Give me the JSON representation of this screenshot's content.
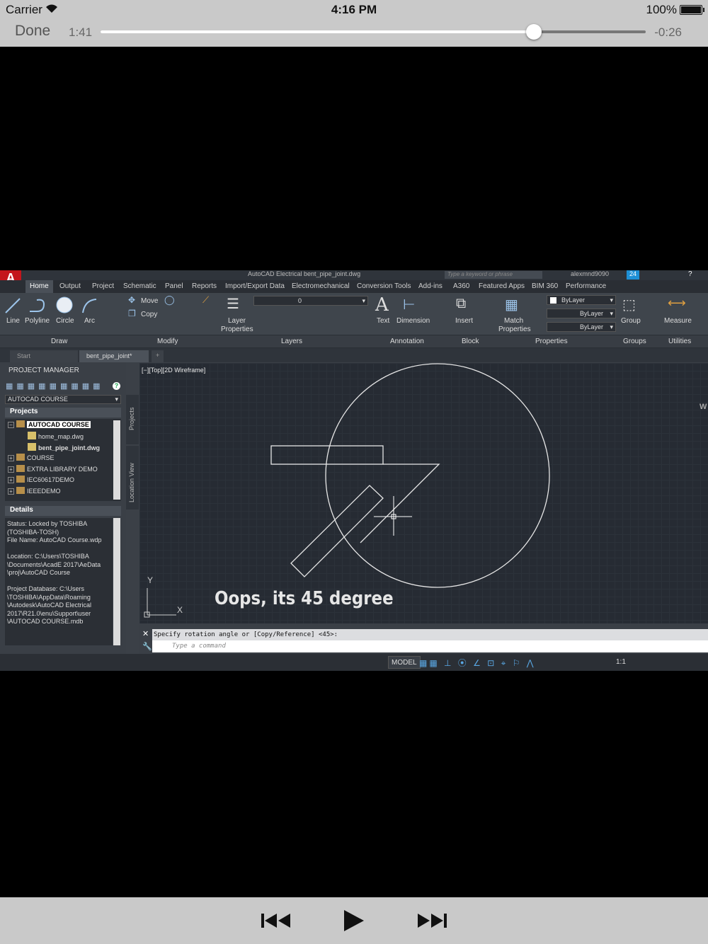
{
  "status_bar": {
    "carrier": "Carrier",
    "time": "4:16 PM",
    "battery": "100%",
    "battery_level": 1.0
  },
  "player": {
    "done_label": "Done",
    "elapsed": "1:41",
    "remaining": "-0:26",
    "progress": 0.795
  },
  "autocad": {
    "logo_letter": "A",
    "title": "AutoCAD Electrical   bent_pipe_joint.dwg",
    "search_placeholder": "Type a keyword or phrase",
    "user": "alexmnd9090",
    "notifications": "24",
    "ribbon_tabs": [
      "Home",
      "Output",
      "Project",
      "Schematic",
      "Panel",
      "Reports",
      "Import/Export Data",
      "Electromechanical",
      "Conversion Tools",
      "Add-ins",
      "A360",
      "Featured Apps",
      "BIM 360",
      "Performance"
    ],
    "tools": {
      "line": "Line",
      "polyline": "Polyline",
      "circle": "Circle",
      "arc": "Arc",
      "move": "Move",
      "copy": "Copy",
      "layer_properties_1": "Layer",
      "layer_properties_2": "Properties",
      "layer_value": "0",
      "text": "Text",
      "dimension": "Dimension",
      "insert": "Insert",
      "match_1": "Match",
      "match_2": "Properties",
      "bylayer_color": "ByLayer",
      "bylayer_linetype": "ByLayer",
      "bylayer_lineweight": "ByLayer",
      "group": "Group",
      "measure": "Measure"
    },
    "panels": {
      "draw": "Draw",
      "modify": "Modify",
      "layers": "Layers",
      "annotation": "Annotation",
      "block": "Block",
      "properties": "Properties",
      "groups": "Groups",
      "utilities": "Utilities"
    },
    "doc_tabs": {
      "start": "Start",
      "active": "bent_pipe_joint*",
      "new": "+"
    },
    "project_manager": {
      "title": "PROJECT MANAGER",
      "project_combo": "AUTOCAD COURSE",
      "projects_header": "Projects",
      "tree": [
        {
          "label": "AUTOCAD COURSE"
        },
        {
          "label": "home_map.dwg"
        },
        {
          "label": "bent_pipe_joint.dwg"
        },
        {
          "label": "COURSE"
        },
        {
          "label": "EXTRA LIBRARY DEMO"
        },
        {
          "label": "IEC60617DEMO"
        },
        {
          "label": "IEEEDEMO"
        }
      ],
      "details_header": "Details",
      "details_text": "Status: Locked by TOSHIBA\n(TOSHIBA-TOSH)\nFile Name: AutoCAD Course.wdp\n\nLocation: C:\\Users\\TOSHIBA\n\\Documents\\AcadE 2017\\AeData\n\\proj\\AutoCAD Course\n\nProject Database: C:\\Users\n\\TOSHIBA\\AppData\\Roaming\n\\Autodesk\\AutoCAD Electrical\n2017\\R21.0\\enu\\Support\\user\n\\AUTOCAD COURSE.mdb",
      "side_tab_projects": "Projects",
      "side_tab_location": "Location View"
    },
    "viewport_label": "[−][Top][2D Wireframe]",
    "ucs_y": "Y",
    "ucs_x": "X",
    "viewcube_letter": "W",
    "subtitle": "Oops, its 45 degree",
    "command_history": "Specify rotation angle or [Copy/Reference] <45>:",
    "command_placeholder": "Type a command",
    "model_label": "MODEL",
    "scale_label": "1:1"
  },
  "colors": {
    "ios_bar": "#c9c9c9",
    "autocad_red": "#c4161c",
    "drawing_bg": "#262b33",
    "accent_blue": "#1e90d6"
  }
}
